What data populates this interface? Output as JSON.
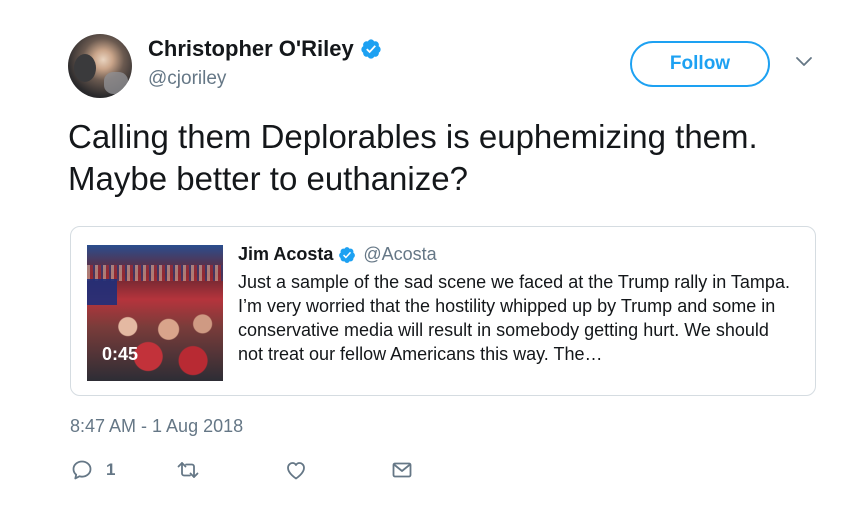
{
  "author": {
    "name": "Christopher O'Riley",
    "handle": "@cjoriley",
    "verified": true
  },
  "follow_button": {
    "label": "Follow"
  },
  "tweet": {
    "text": "Calling them Deplorables is euphemizing them. Maybe better to euthanize?",
    "timestamp": "8:47 AM - 1 Aug 2018"
  },
  "quoted_tweet": {
    "name": "Jim Acosta",
    "handle": "@Acosta",
    "verified": true,
    "text": "Just a sample of the sad scene we faced at the Trump rally in Tampa. I’m very worried that the hostility whipped up by Trump and some in conservative media will result in somebody getting hurt. We should not treat our fellow Americans this way. The…",
    "video_duration": "0:45"
  },
  "actions": {
    "reply_count": "1",
    "icons": [
      "reply-icon",
      "retweet-icon",
      "like-icon",
      "message-icon"
    ]
  },
  "colors": {
    "accent": "#1da1f2",
    "secondary_text": "#657786",
    "border": "#d5dce1"
  }
}
